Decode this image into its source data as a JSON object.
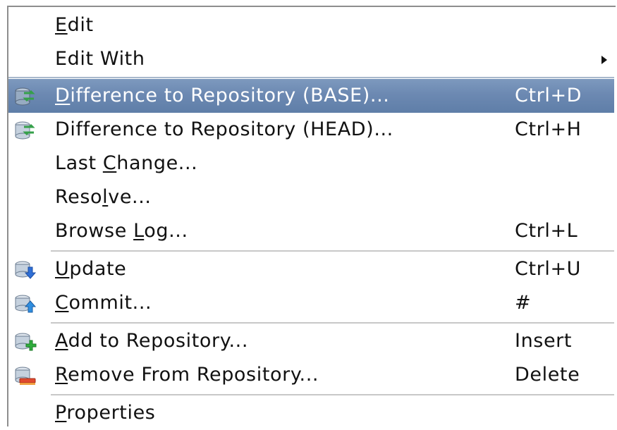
{
  "menu": {
    "items": [
      {
        "id": "edit",
        "pre": "",
        "u": "E",
        "post": "dit",
        "shortcut": "",
        "icon": "",
        "submenu": false,
        "selected": false
      },
      {
        "id": "edit-with",
        "pre": "Edit With",
        "u": "",
        "post": "",
        "shortcut": "",
        "icon": "",
        "submenu": true,
        "selected": false
      },
      {
        "id": "diff-base",
        "pre": "",
        "u": "D",
        "post": "ifference to Repository (BASE)...",
        "shortcut": "Ctrl+D",
        "icon": "repository-diff-icon",
        "submenu": false,
        "selected": true
      },
      {
        "id": "diff-head",
        "pre": "Difference to Repository (HEAD)...",
        "u": "",
        "post": "",
        "shortcut": "Ctrl+H",
        "icon": "repository-diff-icon",
        "submenu": false,
        "selected": false
      },
      {
        "id": "last-change",
        "pre": "Last ",
        "u": "C",
        "post": "hange...",
        "shortcut": "",
        "icon": "",
        "submenu": false,
        "selected": false
      },
      {
        "id": "resolve",
        "pre": "Reso",
        "u": "l",
        "post": "ve...",
        "shortcut": "",
        "icon": "",
        "submenu": false,
        "selected": false
      },
      {
        "id": "browse-log",
        "pre": "Browse ",
        "u": "L",
        "post": "og...",
        "shortcut": "Ctrl+L",
        "icon": "",
        "submenu": false,
        "selected": false
      },
      {
        "id": "update",
        "pre": "",
        "u": "U",
        "post": "pdate",
        "shortcut": "Ctrl+U",
        "icon": "repository-update-icon",
        "submenu": false,
        "selected": false
      },
      {
        "id": "commit",
        "pre": "",
        "u": "C",
        "post": "ommit...",
        "shortcut": "#",
        "icon": "repository-commit-icon",
        "submenu": false,
        "selected": false
      },
      {
        "id": "add",
        "pre": "",
        "u": "A",
        "post": "dd to Repository...",
        "shortcut": "Insert",
        "icon": "repository-add-icon",
        "submenu": false,
        "selected": false
      },
      {
        "id": "remove",
        "pre": "",
        "u": "R",
        "post": "emove From Repository...",
        "shortcut": "Delete",
        "icon": "repository-remove-icon",
        "submenu": false,
        "selected": false
      },
      {
        "id": "properties",
        "pre": "",
        "u": "P",
        "post": "roperties",
        "shortcut": "",
        "icon": "",
        "submenu": false,
        "selected": false
      }
    ]
  },
  "colors": {
    "selection": "#6c89b2",
    "text": "#111111",
    "selected_text": "#ffffff",
    "separator": "#c8c8c8"
  }
}
